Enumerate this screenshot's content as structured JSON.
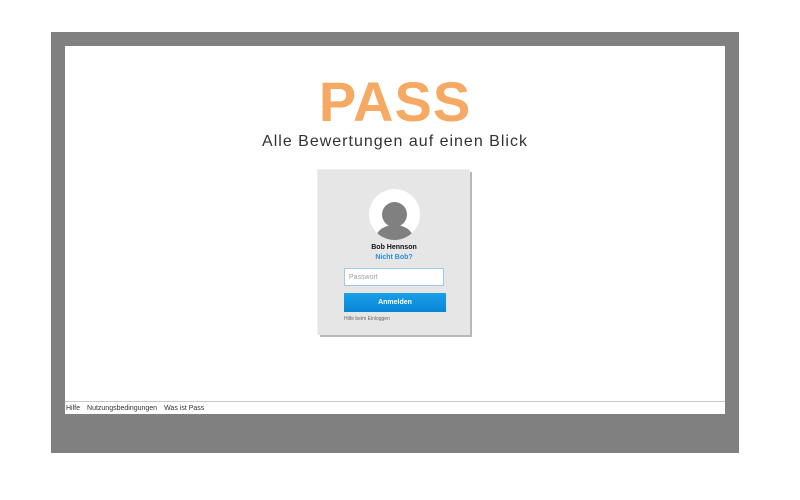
{
  "brand": {
    "logo_text": "PASS",
    "tagline": "Alle Bewertungen auf einen Blick"
  },
  "login": {
    "avatar_icon": "user-avatar-icon",
    "user_name": "Bob Hennson",
    "not_user_link": "Nicht Bob?",
    "password_placeholder": "Passwort",
    "submit_label": "Anmelden",
    "help_link": "Hilfe beim Einloggen"
  },
  "footer": {
    "links": [
      "Hilfe",
      "Nutzungsbedingungen",
      "Was ist Pass"
    ]
  },
  "colors": {
    "logo": "#f5a962",
    "button": "#0a8fdf",
    "link": "#2a8fd4",
    "frame": "#808080",
    "card": "#e6e6e6"
  }
}
